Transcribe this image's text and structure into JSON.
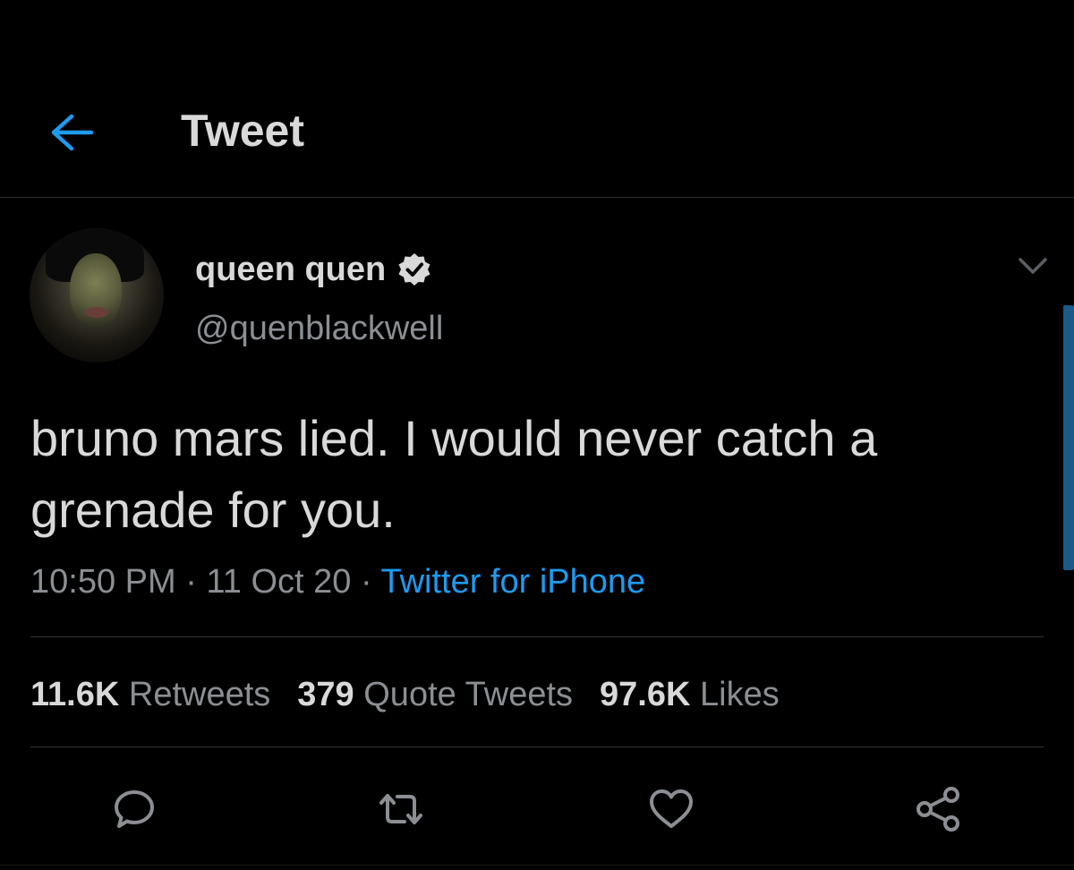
{
  "header": {
    "title": "Tweet",
    "back_icon": "arrow-left-icon",
    "accent_color": "#1d9bf0"
  },
  "author": {
    "display_name": "queen quen",
    "handle": "@quenblackwell",
    "verified": true,
    "verified_icon": "verified-badge-icon"
  },
  "tweet": {
    "text": "bruno mars lied. I would never catch a grenade for you.",
    "time": "10:50 PM",
    "date": "11 Oct 20",
    "separator": "·",
    "source": "Twitter for iPhone"
  },
  "stats": {
    "retweets_count": "11.6K",
    "retweets_label": "Retweets",
    "quotes_count": "379",
    "quotes_label": "Quote Tweets",
    "likes_count": "97.6K",
    "likes_label": "Likes"
  },
  "actions": {
    "reply_icon": "reply-icon",
    "retweet_icon": "retweet-icon",
    "like_icon": "heart-icon",
    "share_icon": "share-icon"
  },
  "colors": {
    "background": "#000000",
    "primary_text": "#d9d9d9",
    "secondary_text": "#8b8f93",
    "link": "#1d9bf0"
  }
}
